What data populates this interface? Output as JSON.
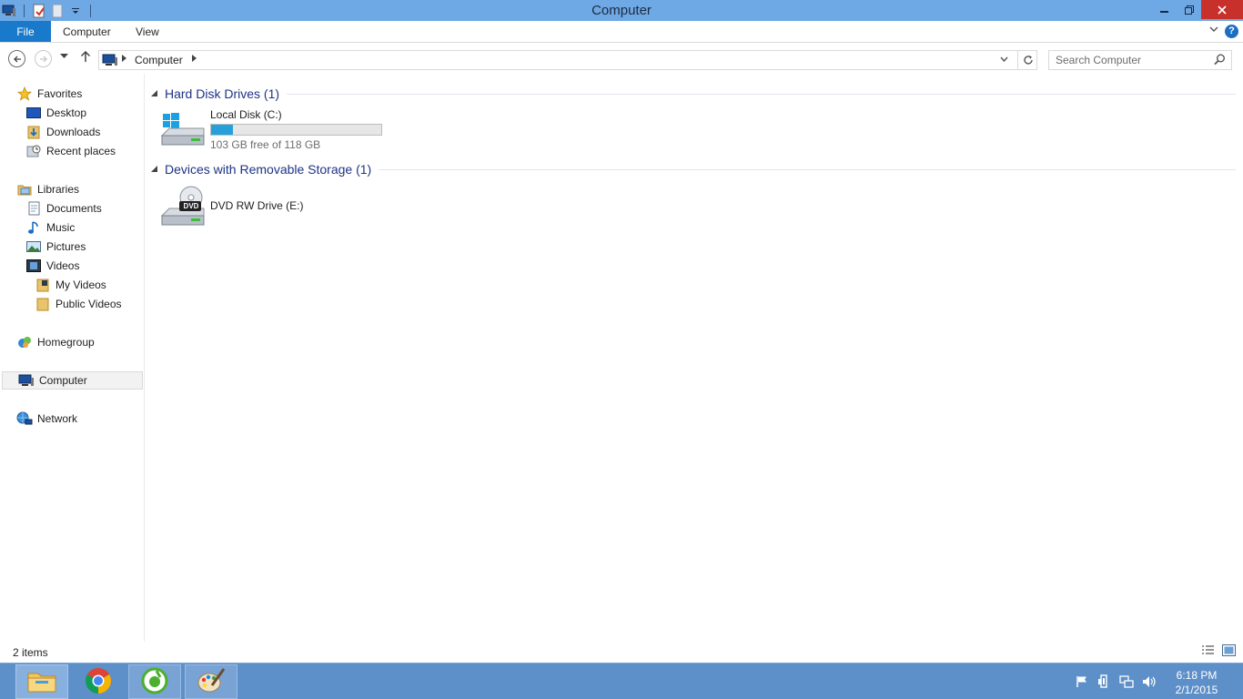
{
  "window": {
    "title": "Computer"
  },
  "ribbon": {
    "tabs": [
      "File",
      "Computer",
      "View"
    ]
  },
  "address": {
    "crumb": "Computer"
  },
  "search": {
    "placeholder": "Search Computer"
  },
  "nav": {
    "favorites": {
      "label": "Favorites",
      "items": [
        "Desktop",
        "Downloads",
        "Recent places"
      ]
    },
    "libraries": {
      "label": "Libraries",
      "items": [
        "Documents",
        "Music",
        "Pictures",
        "Videos"
      ],
      "video_sub": [
        "My Videos",
        "Public Videos"
      ]
    },
    "homegroup": "Homegroup",
    "computer": "Computer",
    "network": "Network"
  },
  "groups": {
    "hdd": {
      "title": "Hard Disk Drives (1)",
      "drive": {
        "name": "Local Disk (C:)",
        "free_text": "103 GB free of 118 GB",
        "used_fraction": 0.127
      }
    },
    "removable": {
      "title": "Devices with Removable Storage (1)",
      "drive": {
        "name": "DVD RW Drive (E:)",
        "badge": "DVD"
      }
    }
  },
  "status": {
    "count": "2 items"
  },
  "clock": {
    "time": "6:18 PM",
    "date": "2/1/2015"
  },
  "colors": {
    "accent": "#1979ca",
    "title_bar": "#6ea9e6",
    "taskbar": "#5d8fc9",
    "close": "#c7302b",
    "usage_bar": "#26a0da"
  }
}
